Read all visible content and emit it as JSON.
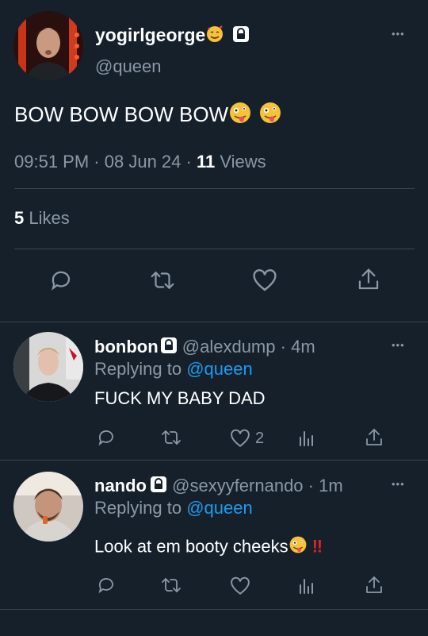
{
  "main_tweet": {
    "display_name": "yogirlgeorge",
    "handle": "@queen",
    "text": "BOW BOW BOW BOW",
    "time": "09:51 PM",
    "date": "08 Jun 24",
    "views_count": "11",
    "views_label": "Views",
    "likes_count": "5",
    "likes_label": "Likes"
  },
  "replies": [
    {
      "display_name": "bonbon",
      "handle": "@alexdump",
      "time": "4m",
      "replying_label": "Replying to",
      "replying_to": "@queen",
      "text": "FUCK MY BABY DAD",
      "like_count": "2"
    },
    {
      "display_name": "nando",
      "handle": "@sexyyfernando",
      "time": "1m",
      "replying_label": "Replying to",
      "replying_to": "@queen",
      "text": "Look at em booty cheeks",
      "suffix": "‼"
    }
  ],
  "separator": "·",
  "more_glyph": "•••",
  "colors": {
    "background": "#15202b",
    "text": "#ffffff",
    "muted": "#8b98a5",
    "link": "#1d9bf0",
    "divider": "#38444d"
  }
}
